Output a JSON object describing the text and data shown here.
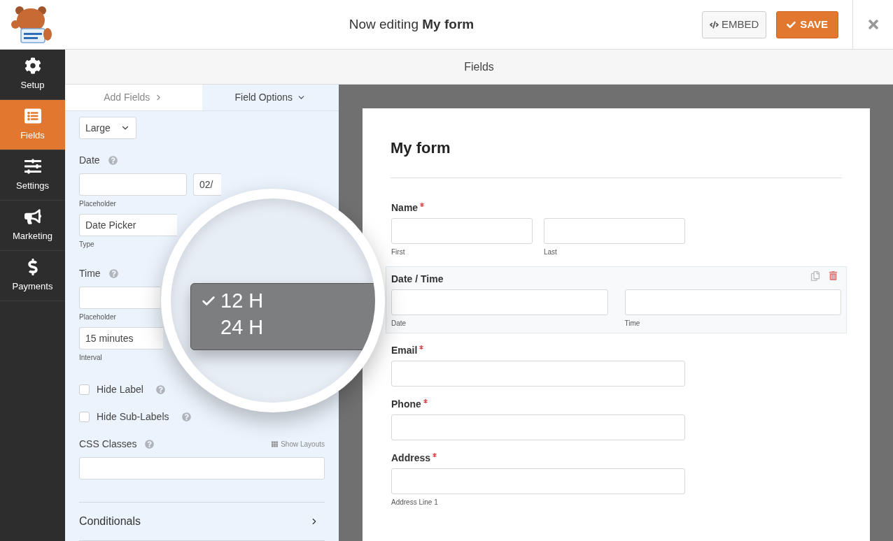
{
  "header": {
    "title": "Now editing **My form**",
    "embed_button": "EMBED",
    "save_button": "SAVE"
  },
  "sidebar": {
    "items": [
      {
        "label": "Setup",
        "selected": false
      },
      {
        "label": "Fields",
        "selected": true
      },
      {
        "label": "Settings",
        "selected": false
      },
      {
        "label": "Marketing",
        "selected": false
      },
      {
        "label": "Payments",
        "selected": false
      }
    ]
  },
  "top_bar": {
    "title": "Fields"
  },
  "panel": {
    "tabs": [
      {
        "label": "Add Fields",
        "selected": false
      },
      {
        "label": "Field Options",
        "selected": true
      }
    ],
    "size_select": "Large",
    "date": {
      "label": "Date",
      "placeholder_sublabel": "Placeholder",
      "format_value": "02/",
      "type_value": "Date Picker",
      "type_sublabel": "Type"
    },
    "time": {
      "label": "Time",
      "placeholder_sublabel": "Placeholder",
      "interval_value": "15 minutes",
      "interval_sublabel": "Interval"
    },
    "checkboxes": [
      {
        "label": "Hide Label",
        "checked": false
      },
      {
        "label": "Hide Sub-Labels",
        "checked": false
      }
    ],
    "css_classes": {
      "label": "CSS Classes",
      "link": "Show Layouts"
    },
    "conditionals": "Conditionals"
  },
  "magnifier": {
    "menu": [
      {
        "label": "12 H",
        "selected": true
      },
      {
        "label": "24 H",
        "selected": false
      }
    ]
  },
  "form": {
    "title": "My form",
    "fields": [
      {
        "kind": "name",
        "label": "Name",
        "required": true,
        "selected": false,
        "sublabels": [
          "First",
          "Last"
        ]
      },
      {
        "kind": "datetime",
        "label": "Date / Time",
        "required": false,
        "selected": true,
        "sublabels": [
          "Date",
          "Time"
        ]
      },
      {
        "kind": "single",
        "label": "Email",
        "required": true,
        "selected": false
      },
      {
        "kind": "single",
        "label": "Phone",
        "required": true,
        "selected": false
      },
      {
        "kind": "single",
        "label": "Address",
        "required": true,
        "selected": false,
        "sublabels": [
          "Address Line 1"
        ]
      }
    ]
  }
}
